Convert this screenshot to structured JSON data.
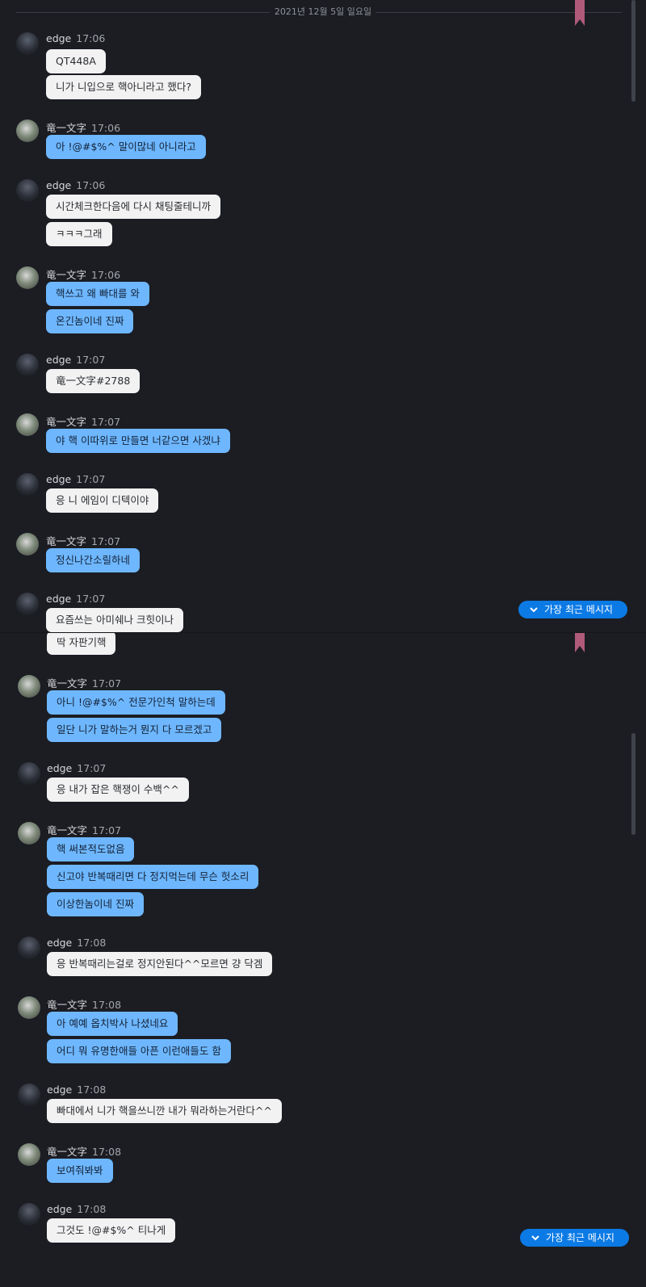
{
  "top": {
    "date_separator": "2021년 12월 5일 일요일",
    "messages": [
      {
        "sender": "edge",
        "time": "17:06",
        "type": "edge",
        "bubbles": [
          "QT448A",
          "니가 니입으로 핵아니라고 했다?"
        ]
      },
      {
        "sender": "竜一文字",
        "time": "17:06",
        "type": "ryu",
        "bubbles": [
          "아 !@#$%^ 말이많네 아니라고"
        ]
      },
      {
        "sender": "edge",
        "time": "17:06",
        "type": "edge",
        "bubbles": [
          "시간체크한다음에 다시 채팅줄테니까",
          "ㅋㅋㅋ그래"
        ]
      },
      {
        "sender": "竜一文字",
        "time": "17:06",
        "type": "ryu",
        "bubbles": [
          "핵쓰고 왜 빠대를 와",
          "온긴놈이네 진짜"
        ]
      },
      {
        "sender": "edge",
        "time": "17:07",
        "type": "edge",
        "bubbles": [
          "竜一文字#2788"
        ]
      },
      {
        "sender": "竜一文字",
        "time": "17:07",
        "type": "ryu",
        "bubbles": [
          "야 핵 이따위로 만들면 너같으면 사겠냐"
        ]
      },
      {
        "sender": "edge",
        "time": "17:07",
        "type": "edge",
        "bubbles": [
          "응 니 에임이 디텍이야"
        ]
      },
      {
        "sender": "竜一文字",
        "time": "17:07",
        "type": "ryu",
        "bubbles": [
          "정신나간소릴하네"
        ]
      },
      {
        "sender": "edge",
        "time": "17:07",
        "type": "edge",
        "bubbles": [
          "요즘쓰는 아미쉐나 크힛이나"
        ]
      }
    ],
    "latest_button": "가장 최근 메시지"
  },
  "bottom": {
    "messages": [
      {
        "sender": "",
        "time": "",
        "type": "edge",
        "bubbles": [
          "딱 자판기핵"
        ]
      },
      {
        "sender": "竜一文字",
        "time": "17:07",
        "type": "ryu",
        "bubbles": [
          "아니 !@#$%^ 전문가인척 말하는데",
          "일단 니가 말하는거 뭔지 다 모르겠고"
        ]
      },
      {
        "sender": "edge",
        "time": "17:07",
        "type": "edge",
        "bubbles": [
          "응 내가 잡은 핵쟁이 수백^^"
        ]
      },
      {
        "sender": "竜一文字",
        "time": "17:07",
        "type": "ryu",
        "bubbles": [
          "핵 써본적도없음",
          "신고야 반복때리면 다 정지먹는데 무슨 헛소리",
          "이상한놈이네 진짜"
        ]
      },
      {
        "sender": "edge",
        "time": "17:08",
        "type": "edge",
        "bubbles": [
          "응 반복때리는걸로 정지안된다^^모르면 걍 닥겜"
        ]
      },
      {
        "sender": "竜一文字",
        "time": "17:08",
        "type": "ryu",
        "bubbles": [
          "아 예예 옵치박사 나셨네요",
          "어디 뭐 유명한애들 아픈 이런애들도 함"
        ]
      },
      {
        "sender": "edge",
        "time": "17:08",
        "type": "edge",
        "bubbles": [
          "빠대에서 니가 핵을쓰니깐 내가 뭐라하는거란다^^"
        ]
      },
      {
        "sender": "竜一文字",
        "time": "17:08",
        "type": "ryu",
        "bubbles": [
          "보여줘봐봐"
        ]
      },
      {
        "sender": "edge",
        "time": "17:08",
        "type": "edge",
        "bubbles": [
          "그것도 !@#$%^ 티나게"
        ]
      }
    ],
    "latest_button": "가장 최근 메시지"
  },
  "colors": {
    "background": "#1b1d23",
    "edge_bubble": "#f2f2f3",
    "ryu_bubble": "#6eb7ff",
    "accent": "#0b7ae5",
    "ribbon": "#b05a7a"
  },
  "icons": {
    "edge_avatar": "dark-hooded-figure-avatar",
    "ryu_avatar": "character-avatar",
    "latest_button_icon": "chevron-down-icon"
  }
}
